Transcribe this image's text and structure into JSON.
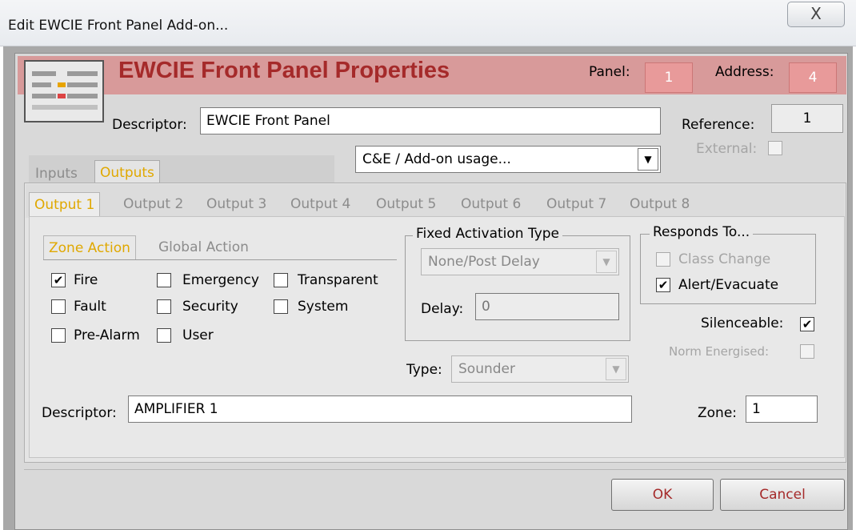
{
  "window": {
    "title": "Edit EWCIE Front Panel Add-on...",
    "close_glyph": "X"
  },
  "header": {
    "title": "EWCIE Front Panel Properties",
    "panel_label": "Panel:",
    "panel_value": "1",
    "address_label": "Address:",
    "address_value": "4"
  },
  "descriptor": {
    "label": "Descriptor:",
    "value": "EWCIE Front Panel"
  },
  "reference": {
    "label": "Reference:",
    "value": "1"
  },
  "usage_select": {
    "value": "C&E / Add-on usage..."
  },
  "external": {
    "label": "External:",
    "checked": false
  },
  "outer_tabs": [
    {
      "label": "Inputs",
      "active": false
    },
    {
      "label": "Outputs",
      "active": true
    }
  ],
  "output_tabs": [
    "Output 1",
    "Output 2",
    "Output 3",
    "Output 4",
    "Output 5",
    "Output 6",
    "Output 7",
    "Output 8"
  ],
  "action_tabs": [
    {
      "label": "Zone Action",
      "active": true
    },
    {
      "label": "Global Action",
      "active": false
    }
  ],
  "checkboxes": {
    "fire": {
      "label": "Fire",
      "checked": true
    },
    "emergency": {
      "label": "Emergency",
      "checked": false
    },
    "transparent": {
      "label": "Transparent",
      "checked": false
    },
    "fault": {
      "label": "Fault",
      "checked": false
    },
    "security": {
      "label": "Security",
      "checked": false
    },
    "system": {
      "label": "System",
      "checked": false
    },
    "pre_alarm": {
      "label": "Pre-Alarm",
      "checked": false
    },
    "user": {
      "label": "User",
      "checked": false
    }
  },
  "fixed_activation": {
    "title": "Fixed Activation Type",
    "value": "None/Post Delay",
    "delay_label": "Delay:",
    "delay_value": "0"
  },
  "type": {
    "label": "Type:",
    "value": "Sounder"
  },
  "responds_to": {
    "title": "Responds To...",
    "class_change": {
      "label": "Class Change",
      "checked": false
    },
    "alert_evacuate": {
      "label": "Alert/Evacuate",
      "checked": true
    }
  },
  "silenceable": {
    "label": "Silenceable:",
    "checked": true
  },
  "norm_energised": {
    "label": "Norm Energised:",
    "checked": false
  },
  "output_descriptor": {
    "label": "Descriptor:",
    "value": "AMPLIFIER 1"
  },
  "zone": {
    "label": "Zone:",
    "value": "1"
  },
  "buttons": {
    "ok": "OK",
    "cancel": "Cancel"
  },
  "check_glyph": "✔",
  "dropdown_glyph": "▼",
  "colors": {
    "accent_tab": "#e0a800",
    "header_band": "#d89a9a",
    "title_red": "#a52a2a"
  }
}
